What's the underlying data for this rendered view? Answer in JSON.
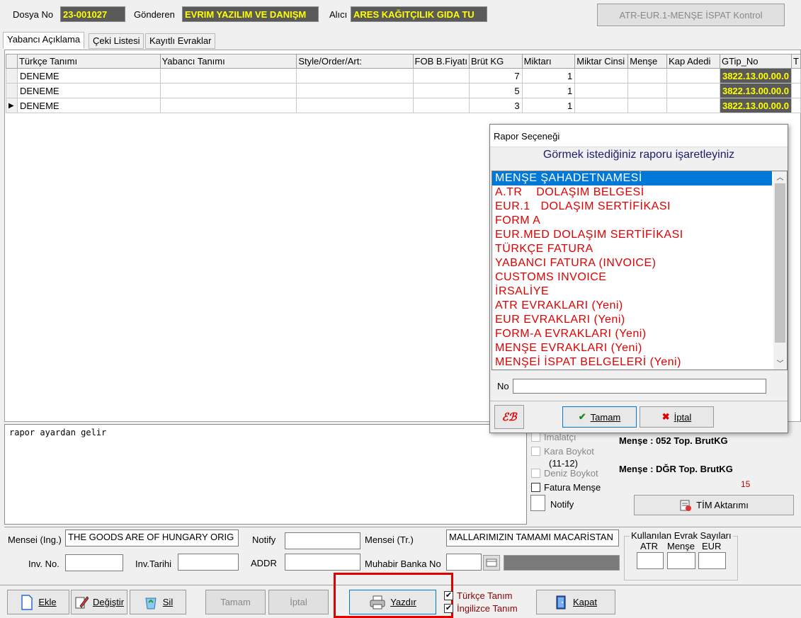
{
  "header": {
    "dosya_label": "Dosya No",
    "dosya_value": "23-001027",
    "gonderen_label": "Gönderen",
    "gonderen_value": "EVRIM YAZILIM VE DANIŞM",
    "alici_label": "Alıcı",
    "alici_value": "ARES KAĞITÇILIK GIDA TU",
    "kontrol_button": "ATR-EUR.1-MENŞE İSPAT Kontrol"
  },
  "tabs": [
    "Yabancı Açıklama",
    "Çeki Listesi",
    "Kayıtlı Evraklar"
  ],
  "grid": {
    "columns": [
      "Türkçe Tanımı",
      "Yabancı Tanımı",
      "Style/Order/Art:",
      "FOB B.Fiyatı",
      "Brüt KG",
      "Miktarı",
      "Miktar Cinsi",
      "Menşe",
      "Kap Adedi",
      "GTip_No",
      "T"
    ],
    "rows": [
      {
        "turkce": "DENEME",
        "yabanci": "",
        "style": "",
        "fob": "",
        "brut": "7",
        "miktar": "1",
        "cins": "",
        "mense": "",
        "kap": "",
        "gtip": "3822.13.00.00.0",
        "t": ""
      },
      {
        "turkce": "DENEME",
        "yabanci": "",
        "style": "",
        "fob": "",
        "brut": "5",
        "miktar": "1",
        "cins": "",
        "mense": "",
        "kap": "",
        "gtip": "3822.13.00.00.0",
        "t": ""
      },
      {
        "turkce": "DENEME",
        "yabanci": "",
        "style": "",
        "fob": "",
        "brut": "3",
        "miktar": "1",
        "cins": "",
        "mense": "",
        "kap": "",
        "gtip": "3822.13.00.00.0",
        "t": ""
      }
    ]
  },
  "memo_text": "rapor ayardan gelir",
  "right_panel": {
    "imalatci": "İmalatçı",
    "kara_boykot": "Kara Boykot",
    "kara_boykot_sub": "(11-12)",
    "deniz_boykot": "Deniz Boykot",
    "fatura_mense": "Fatura Menşe",
    "notify": "Notify",
    "mense_052": "Menşe : 052  Top. BrutKG",
    "mense_dgr": "Menşe : DĞR  Top. BrutKG",
    "dgr_value": "15",
    "tim_button": "TİM Aktarımı"
  },
  "bottom_fields": {
    "mensei_ing_label": "Mensei (Ing.)",
    "mensei_ing_value": "THE GOODS ARE OF HUNGARY ORIG",
    "notify_label": "Notify",
    "mensei_tr_label": "Mensei (Tr.)",
    "mensei_tr_value": "MALLARIMIZIN TAMAMI MACARİSTAN",
    "inv_no_label": "Inv. No.",
    "inv_tarihi_label": "Inv.Tarihi",
    "addr_label": "ADDR",
    "muhabir_label": "Muhabir Banka No",
    "kullanilan_label": "Kullanılan Evrak Sayıları",
    "atr_label": "ATR",
    "mense_label": "Menşe",
    "eur_label": "EUR"
  },
  "toolbar": {
    "ekle": "Ekle",
    "degistir": "Değiştir",
    "sil": "Sil",
    "tamam": "Tamam",
    "iptal": "İptal",
    "yazdir": "Yazdır",
    "turkce_tanim": "Türkçe Tanım",
    "ingilizce_tanim": "İngilizce Tanım",
    "kapat": "Kapat"
  },
  "dialog": {
    "title": "Rapor Seçeneği",
    "subtitle": "Görmek istediğiniz raporu işaretleyiniz",
    "items": [
      "MENŞE ŞAHADETNAMESİ",
      "A.TR    DOLAŞIM BELGESİ",
      "EUR.1   DOLAŞIM SERTİFİKASI",
      "FORM A",
      "EUR.MED DOLAŞIM SERTİFİKASI",
      "TÜRKÇE FATURA",
      "YABANCI FATURA (INVOICE)",
      "CUSTOMS INVOICE",
      "İRSALİYE",
      "ATR EVRAKLARI (Yeni)",
      "EUR EVRAKLARI (Yeni)",
      "FORM-A EVRAKLARI (Yeni)",
      "MENŞE EVRAKLARI (Yeni)",
      "MENŞEİ İSPAT BELGELERİ (Yeni)"
    ],
    "no_label": "No",
    "tamam": "Tamam",
    "iptal": "İptal"
  },
  "colors": {
    "accent": "#0078d7",
    "highlight_field": "#5a5a5a",
    "highlight_text": "#ffff00",
    "list_text": "#e00000",
    "callout": "#e00000"
  }
}
